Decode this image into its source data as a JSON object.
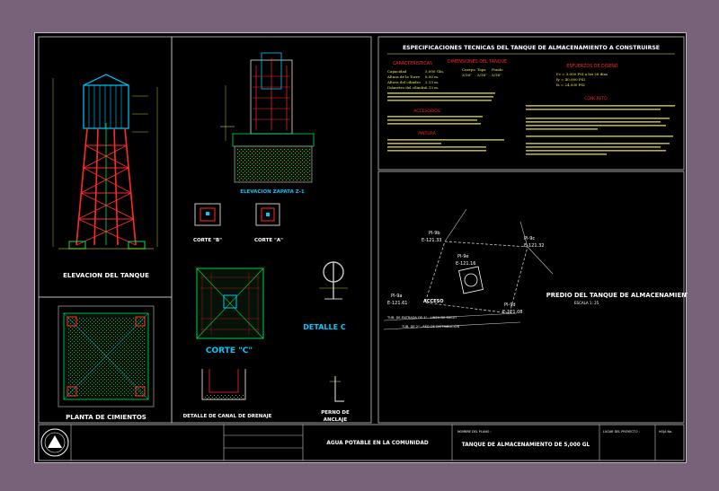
{
  "colors": {
    "background": "#77627a",
    "sheet": "#000000",
    "frame": "#c8c8c8",
    "heading": "#ffffff",
    "cyan": "#00c8ff",
    "red": "#ff2a2a",
    "green": "#00e050",
    "yellow": "#f2ee4a",
    "magenta": "#e64ad8"
  },
  "panels": {
    "elevation_tank": "ELEVACION DEL TANQUE",
    "elevation_footing": "ELEVACION ZAPATA Z-1",
    "cut_b": "CORTE \"B\"",
    "cut_a": "CORTE \"A\"",
    "cut_c": "CORTE \"C\"",
    "detail_c": "DETALLE C",
    "foundation_plan": "PLANTA DE CIMIENTOS",
    "drain_detail": "DETALLE DE CANAL DE DRENAJE",
    "anchor_bolt_line1": "PERNO DE",
    "anchor_bolt_line2": "ANCLAJE"
  },
  "specs": {
    "title": "ESPECIFICACIONES TECNICAS DEL TANQUE DE ALMACENAMIENTO A CONSTRUIRSE",
    "characteristics": "CARACTERISTICAS",
    "dimensions": "DIMENSIONES DEL TANQUE",
    "design_effort": "ESFUERZOS DE DISEÑO",
    "accessories": "ACCESORIOS",
    "paint": "PINTURA",
    "concrete": "CONCRETO",
    "cap_label": "Capacidad",
    "cap_value": "5,000 Gln.",
    "height_tower_label": "Altura de la Torre",
    "height_tower_value": "8.00 m.",
    "height_cyl_label": "Altura del cilindro",
    "height_cyl_value": "2.13 m.",
    "diam_label": "Diámetro del cilindro",
    "diam_value": "2.13 m.",
    "dim_headers": [
      "Cuerpo",
      "Tapa",
      "Fondo"
    ],
    "dim_values": [
      "3/16\"",
      "3/16\"",
      "3/16\""
    ],
    "concrete_fc": "f'c = 3,000 PSI a los 28 días",
    "steel_fy": "fy = 40,000 PSI",
    "steel_fs": "fs = 24,000 PSI"
  },
  "site": {
    "title": "PREDIO DEL TANQUE DE ALMACENAMIENTO",
    "scale": "ESCALA 1: 25",
    "points": [
      "Pl-9b",
      "E-121.33",
      "Pl-9c",
      "E-121.32",
      "Pl-9e",
      "E-121.16",
      "Pl-9a",
      "E-121.61",
      "Pl-9d",
      "E-121.08"
    ],
    "access": "ACCESO",
    "street": "TUB. DE ENTRADA DE 1\" - LINEA DE RIEGO",
    "distribution": "TUB. DE 2\" - RED DE DISTRIBUCION"
  },
  "title_block": {
    "project_label": "AGUA POTABLE EN LA COMUNIDAD",
    "sheet_label": "TANQUE DE ALMACENAMIENTO DE 5,000 GL",
    "name_label": "NOMBRE DEL PLANO :",
    "project_field": "LUGAR DEL PROYECTO :",
    "page_label": "HOJA No."
  }
}
